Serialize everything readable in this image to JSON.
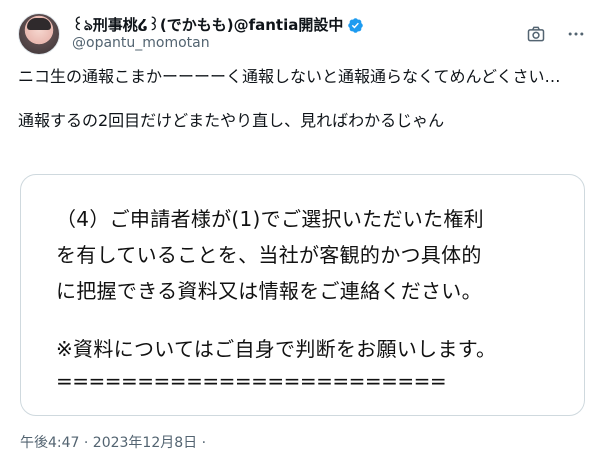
{
  "author": {
    "display_name": "꒰ঌ刑事桃໒꒱(でかもも)@fantia開設中",
    "handle": "@opantu_momotan",
    "verified": true,
    "avatar_icon": "avatar"
  },
  "actions": {
    "media_icon": "camera-icon",
    "more_icon": "more-icon"
  },
  "tweet": {
    "text": "ニコ生の通報こまかーーーーく通報しないと通報通らなくてめんどくさい…\n\n通報するの2回目だけどまたやり直し、見ればわかるじゃん"
  },
  "media": {
    "line1": "（4）ご申請者様が(1)でご選択いただいた権利",
    "line2": "を有していることを、当社が客観的かつ具体的",
    "line3": "に把握できる資料又は情報をご連絡ください。",
    "line4": "※資料についてはご自身で判断をお願いします。",
    "line5": "========================"
  },
  "meta": {
    "timestamp": "午後4:47 · 2023年12月8日 ·"
  },
  "colors": {
    "verified": "#1d9bf0",
    "secondary_text": "#536471",
    "border": "#cfd9de"
  }
}
